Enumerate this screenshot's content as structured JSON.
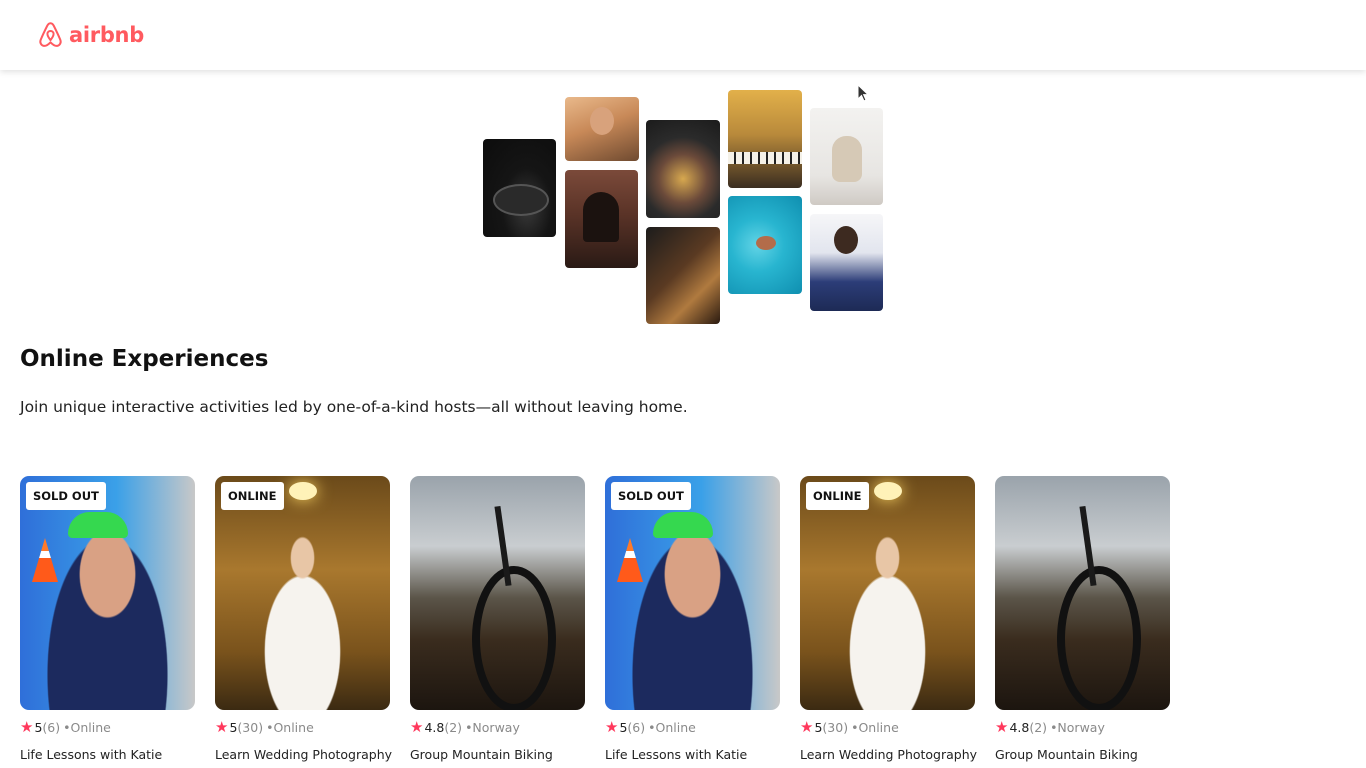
{
  "brand": {
    "name": "airbnb",
    "color": "#ff5a5f",
    "logo_icon": "airbnb-belo-icon"
  },
  "hero": {
    "photos": [
      "cooking-photo",
      "woman-portrait-photo",
      "doorway-dancer-photo",
      "food-bowl-photo",
      "guitar-photo",
      "piano-singer-photo",
      "swimmer-photo",
      "yoga-photo",
      "singer-photo"
    ]
  },
  "section": {
    "title": "Online Experiences",
    "description": "Join unique interactive activities led by one-of-a-kind hosts—all without leaving home."
  },
  "cards": [
    {
      "badge": "SOLD OUT",
      "rating": "5",
      "reviews": "(6)",
      "location": "•Online",
      "title": "Life Lessons with Katie",
      "photo": "swimmer-athlete-photo"
    },
    {
      "badge": "ONLINE",
      "rating": "5",
      "reviews": "(30)",
      "location": "•Online",
      "title": "Learn Wedding Photography",
      "photo": "bride-photo"
    },
    {
      "badge": "",
      "rating": "4.8",
      "reviews": "(2)",
      "location": "•Norway",
      "title": "Group Mountain Biking",
      "photo": "mountain-bike-photo"
    },
    {
      "badge": "SOLD OUT",
      "rating": "5",
      "reviews": "(6)",
      "location": "•Online",
      "title": "Life Lessons with Katie",
      "photo": "swimmer-athlete-photo"
    },
    {
      "badge": "ONLINE",
      "rating": "5",
      "reviews": "(30)",
      "location": "•Online",
      "title": "Learn Wedding Photography",
      "photo": "bride-photo"
    },
    {
      "badge": "",
      "rating": "4.8",
      "reviews": "(2)",
      "location": "•Norway",
      "title": "Group Mountain Biking",
      "photo": "mountain-bike-photo"
    }
  ],
  "colors": {
    "star": "#ff385c",
    "muted": "#8a8a8a"
  }
}
